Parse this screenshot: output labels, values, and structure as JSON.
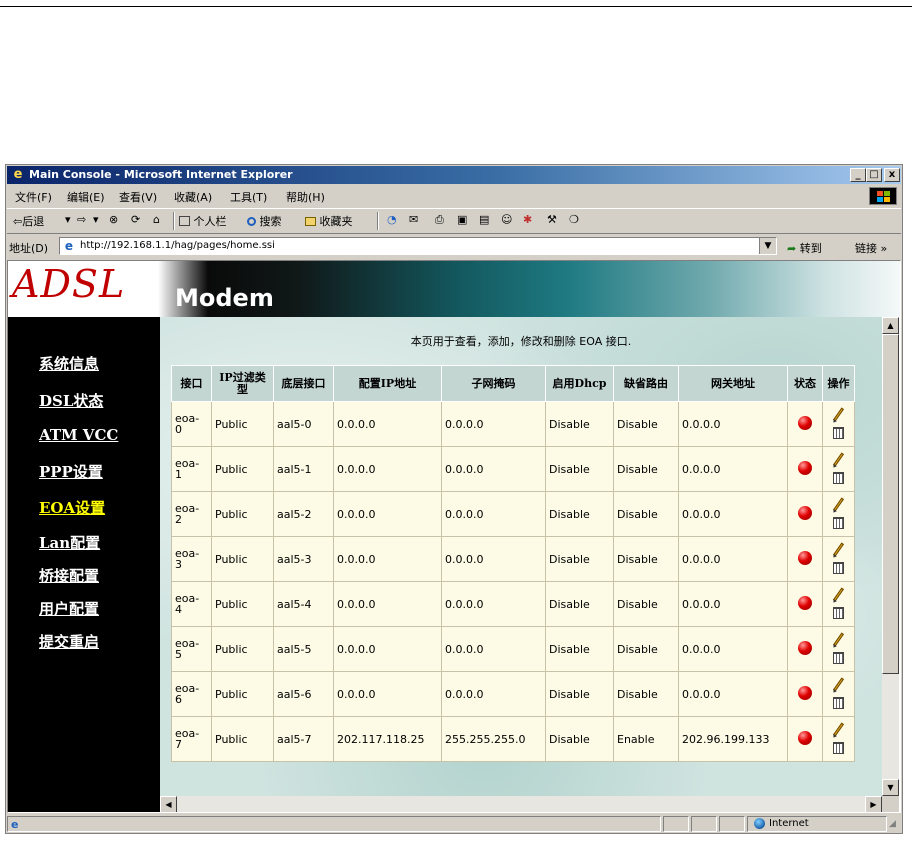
{
  "window": {
    "title": "Main Console - Microsoft Internet Explorer",
    "minimize": "_",
    "maximize": "□",
    "close": "x"
  },
  "menu": [
    "文件(F)",
    "编辑(E)",
    "查看(V)",
    "收藏(A)",
    "工具(T)",
    "帮助(H)"
  ],
  "toolbar": {
    "back": "⇦后退",
    "back_drop": "▾",
    "forward": "⇨",
    "forward_drop": "▾",
    "stop": "⊗",
    "refresh": "⟳",
    "home": "⌂",
    "personal": "个人栏",
    "search": "搜索",
    "favorites": "收藏夹"
  },
  "address": {
    "label": "地址(D)",
    "url": "http://192.168.1.1/hag/pages/home.ssi",
    "dropdown": "▼",
    "go": "转到",
    "links": "链接 »"
  },
  "banner": {
    "brand": "ADSL",
    "product": "Modem"
  },
  "nav": [
    {
      "label": "系统信息",
      "active": false
    },
    {
      "label": "DSL状态",
      "active": false
    },
    {
      "label": "ATM VCC",
      "active": false
    },
    {
      "label": "PPP设置",
      "active": false
    },
    {
      "label": "EOA设置",
      "active": true
    },
    {
      "label": "Lan配置",
      "active": false
    },
    {
      "label": "桥接配置",
      "active": false
    },
    {
      "label": "用户配置",
      "active": false
    },
    {
      "label": "提交重启",
      "active": false
    }
  ],
  "page": {
    "description": "本页用于查看，添加，修改和删除 EOA 接口."
  },
  "table": {
    "headers": [
      "接口",
      "IP过滤类型",
      "底层接口",
      "配置IP地址",
      "子网掩码",
      "启用Dhcp",
      "缺省路由",
      "网关地址",
      "状态",
      "操作"
    ],
    "rows": [
      {
        "iface_a": "eoa-",
        "iface_b": "0",
        "filter": "Public",
        "lower": "aal5-0",
        "ip": "0.0.0.0",
        "mask": "0.0.0.0",
        "dhcp": "Disable",
        "route": "Disable",
        "gateway": "0.0.0.0"
      },
      {
        "iface_a": "eoa-",
        "iface_b": "1",
        "filter": "Public",
        "lower": "aal5-1",
        "ip": "0.0.0.0",
        "mask": "0.0.0.0",
        "dhcp": "Disable",
        "route": "Disable",
        "gateway": "0.0.0.0"
      },
      {
        "iface_a": "eoa-",
        "iface_b": "2",
        "filter": "Public",
        "lower": "aal5-2",
        "ip": "0.0.0.0",
        "mask": "0.0.0.0",
        "dhcp": "Disable",
        "route": "Disable",
        "gateway": "0.0.0.0"
      },
      {
        "iface_a": "eoa-",
        "iface_b": "3",
        "filter": "Public",
        "lower": "aal5-3",
        "ip": "0.0.0.0",
        "mask": "0.0.0.0",
        "dhcp": "Disable",
        "route": "Disable",
        "gateway": "0.0.0.0"
      },
      {
        "iface_a": "eoa-",
        "iface_b": "4",
        "filter": "Public",
        "lower": "aal5-4",
        "ip": "0.0.0.0",
        "mask": "0.0.0.0",
        "dhcp": "Disable",
        "route": "Disable",
        "gateway": "0.0.0.0"
      },
      {
        "iface_a": "eoa-",
        "iface_b": "5",
        "filter": "Public",
        "lower": "aal5-5",
        "ip": "0.0.0.0",
        "mask": "0.0.0.0",
        "dhcp": "Disable",
        "route": "Disable",
        "gateway": "0.0.0.0"
      },
      {
        "iface_a": "eoa-",
        "iface_b": "6",
        "filter": "Public",
        "lower": "aal5-6",
        "ip": "0.0.0.0",
        "mask": "0.0.0.0",
        "dhcp": "Disable",
        "route": "Disable",
        "gateway": "0.0.0.0"
      },
      {
        "iface_a": "eoa-",
        "iface_b": "7",
        "filter": "Public",
        "lower": "aal5-7",
        "ip": "202.117.118.25",
        "mask": "255.255.255.0",
        "dhcp": "Disable",
        "route": "Enable",
        "gateway": "202.96.199.133"
      }
    ]
  },
  "statusbar": {
    "zone": "Internet"
  },
  "icons": {
    "status": "red-status-dot",
    "edit": "pencil-icon",
    "delete": "trash-icon"
  }
}
